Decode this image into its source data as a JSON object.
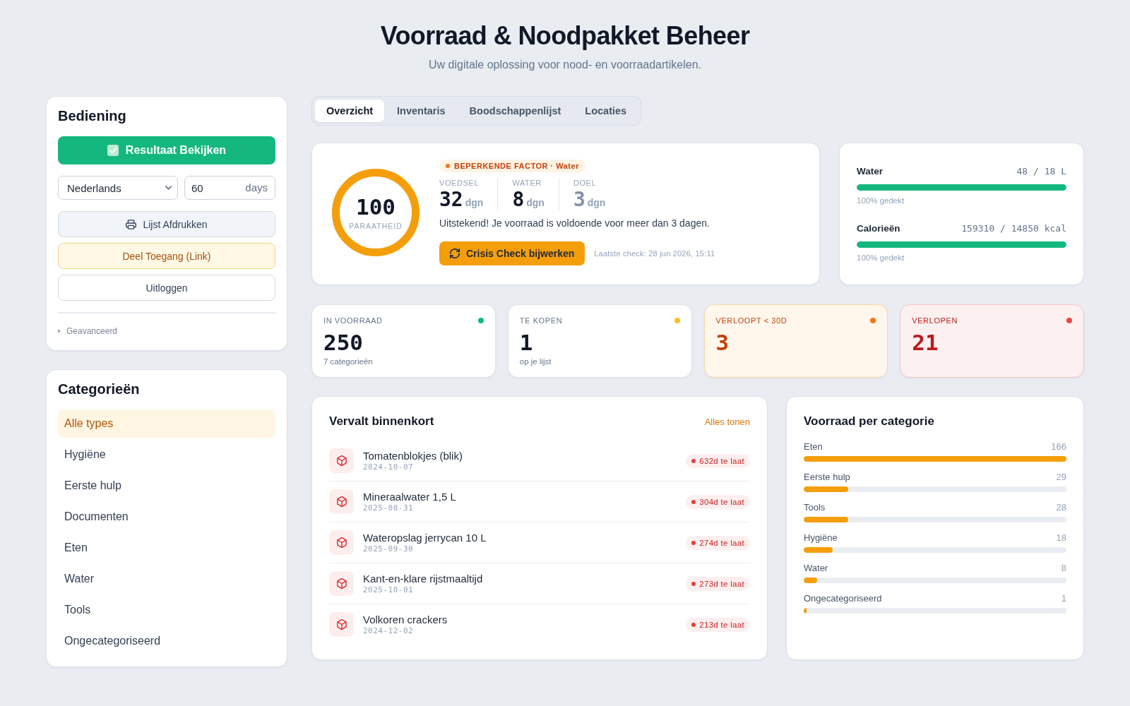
{
  "header": {
    "title": "Voorraad & Noodpakket Beheer",
    "subtitle": "Uw digitale oplossing voor nood- en voorraadartikelen."
  },
  "controls": {
    "title": "Bediening",
    "primary_button": "Resultaat Bekijken",
    "language": "Nederlands",
    "days": {
      "value": "60",
      "unit": "days"
    },
    "buttons": [
      {
        "label": "Lijst Afdrukken",
        "kind": "print"
      },
      {
        "label": "Deel Toegang (Link)",
        "kind": "share"
      },
      {
        "label": "Uitloggen",
        "kind": "plain"
      }
    ],
    "advanced": {
      "label": "Geavanceerd",
      "expanded": false
    }
  },
  "categories": {
    "title": "Categorieën",
    "items": [
      {
        "label": "Alle types",
        "selected": true
      },
      {
        "label": "Hygiëne",
        "selected": false
      },
      {
        "label": "Eerste hulp",
        "selected": false
      },
      {
        "label": "Documenten",
        "selected": false
      },
      {
        "label": "Eten",
        "selected": false
      },
      {
        "label": "Water",
        "selected": false
      },
      {
        "label": "Tools",
        "selected": false
      },
      {
        "label": "Ongecategoriseerd",
        "selected": false
      }
    ]
  },
  "tabs": [
    {
      "label": "Overzicht",
      "selected": true
    },
    {
      "label": "Inventaris",
      "selected": false
    },
    {
      "label": "Boodschappenlijst",
      "selected": false
    },
    {
      "label": "Locaties",
      "selected": false
    }
  ],
  "readiness": {
    "score": "100",
    "label": "PARAATHEID",
    "factor": "BEPERKENDE FACTOR · Water",
    "stats": [
      {
        "label": "VOEDSEL",
        "value": "32",
        "unit": "dgn",
        "kind": "actual"
      },
      {
        "label": "WATER",
        "value": "8",
        "unit": "dgn",
        "kind": "actual"
      },
      {
        "label": "DOEL",
        "value": "3",
        "unit": "dgn",
        "kind": "target"
      }
    ],
    "message": "Uitstekend! Je voorraad is voldoende voor meer dan 3 dagen.",
    "button": "Crisis Check bijwerken",
    "last_check": "Laatste check: 28 jun 2026, 15:11"
  },
  "supply": [
    {
      "label": "Water",
      "amount": "48 / 18 L",
      "level": 1,
      "coverage": "100% gedekt"
    },
    {
      "label": "Calorieën",
      "amount": "159310 / 14850 kcal",
      "level": 1,
      "coverage": "100% gedekt"
    }
  ],
  "stat_cards": [
    {
      "label": "IN VOORRAAD",
      "value": "250",
      "note": "7 categorieën",
      "kind": "neutral",
      "color": "#10b981"
    },
    {
      "label": "TE KOPEN",
      "value": "1",
      "note": "op je lijst",
      "kind": "neutral",
      "color": "#fbbf24"
    },
    {
      "label": "VERLOOPT < 30D",
      "value": "3",
      "kind": "warning",
      "color": "#f97316"
    },
    {
      "label": "VERLOPEN",
      "value": "21",
      "kind": "danger",
      "color": "#ef4444"
    }
  ],
  "expiring": {
    "title": "Vervalt binnenkort",
    "link": "Alles tonen",
    "items": [
      {
        "name": "Tomatenblokjes (blik)",
        "date": "2024-10-07",
        "status": "632d te laat"
      },
      {
        "name": "Mineraalwater 1,5 L",
        "date": "2025-08-31",
        "status": "304d te laat"
      },
      {
        "name": "Wateropslag jerrycan 10 L",
        "date": "2025-09-30",
        "status": "274d te laat"
      },
      {
        "name": "Kant-en-klare rijstmaaltijd",
        "date": "2025-10-01",
        "status": "273d te laat"
      },
      {
        "name": "Volkoren crackers",
        "date": "2024-12-02",
        "status": "213d te laat"
      }
    ]
  },
  "per_category": {
    "title": "Voorraad per categorie",
    "items": [
      {
        "label": "Eten",
        "count": "166",
        "level": 1
      },
      {
        "label": "Eerste hulp",
        "count": "29",
        "level": 0.17
      },
      {
        "label": "Tools",
        "count": "28",
        "level": 0.17
      },
      {
        "label": "Hygiëne",
        "count": "18",
        "level": 0.11
      },
      {
        "label": "Water",
        "count": "8",
        "level": 0.05
      },
      {
        "label": "Ongecategoriseerd",
        "count": "1",
        "level": 0.01
      }
    ]
  }
}
